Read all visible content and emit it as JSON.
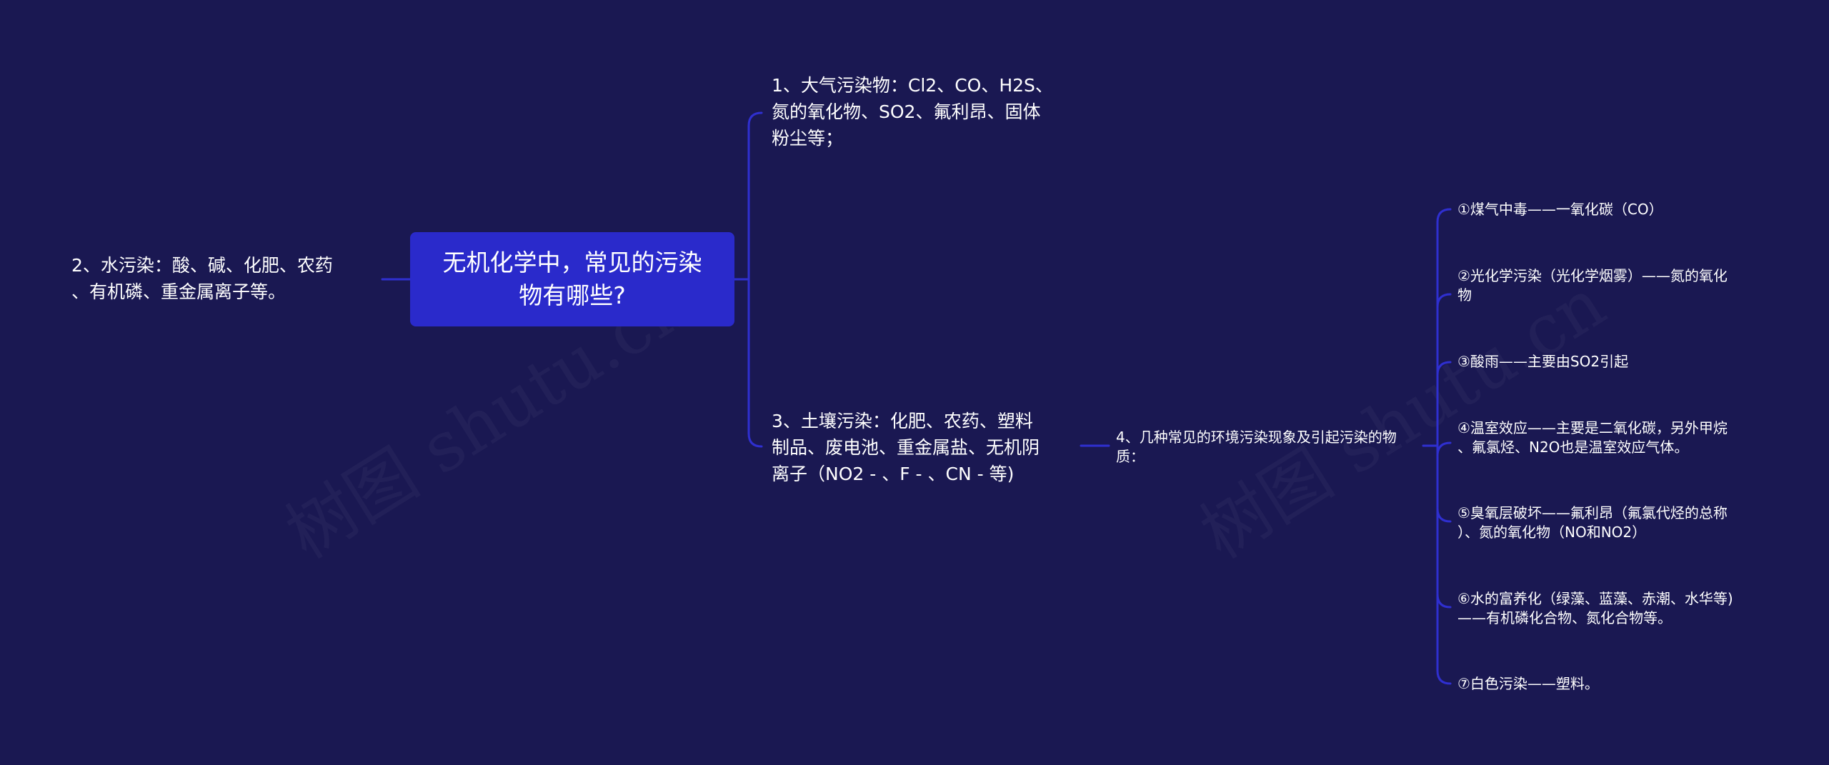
{
  "watermark": [
    "树图 shutu.cn",
    "树图 shutu.cn"
  ],
  "root": {
    "label": "无机化学中，常见的污染物有哪些?",
    "line1": "无机化学中，常见的污染",
    "line2": "物有哪些?"
  },
  "branches": {
    "left": [
      {
        "id": "water",
        "text": "2、水污染：酸、碱、化肥、农药\n、有机磷、重金属离子等。"
      }
    ],
    "right": [
      {
        "id": "air",
        "text": "1、大气污染物：Cl2、CO、H2S、\n氮的氧化物、SO2、氟利昂、固体\n粉尘等；"
      },
      {
        "id": "soil",
        "text": "3、土壤污染：化肥、农药、塑料\n制品、废电池、重金属盐、无机阴\n离子（NO2 - 、F - 、CN - 等)"
      }
    ],
    "phenomena": {
      "text": "4、几种常见的环境污染现象及引起污染的物\n质：",
      "items": [
        "①煤气中毒——一氧化碳（CO）",
        "②光化学污染（光化学烟雾）——氮的氧化\n物",
        "③酸雨——主要由SO2引起",
        "④温室效应——主要是二氧化碳，另外甲烷\n、氟氯烃、N2O也是温室效应气体。",
        "⑤臭氧层破坏——氟利昂（氟氯代烃的总称\n）、氮的氧化物（NO和NO2）",
        "⑥水的富养化（绿藻、蓝藻、赤潮、水华等)\n——有机磷化合物、氮化合物等。",
        "⑦白色污染——塑料。"
      ]
    }
  },
  "colors": {
    "background": "#1a1852",
    "root_fill": "#2a2acb",
    "link": "#2f2fd0",
    "text": "#ffffff"
  }
}
